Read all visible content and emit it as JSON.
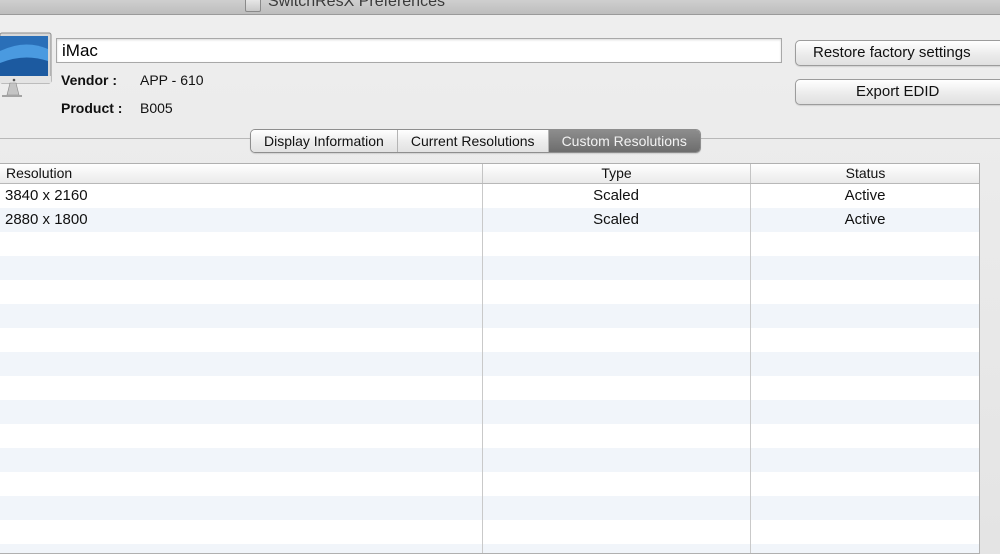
{
  "window": {
    "title": "SwitchResX Preferences"
  },
  "display": {
    "name": "iMac",
    "vendor_label": "Vendor :",
    "vendor_value": "APP - 610",
    "product_label": "Product :",
    "product_value": "B005"
  },
  "buttons": {
    "restore": "Restore factory settings",
    "export": "Export EDID"
  },
  "tabs": [
    {
      "label": "Display Information",
      "selected": false
    },
    {
      "label": "Current Resolutions",
      "selected": false
    },
    {
      "label": "Custom Resolutions",
      "selected": true
    }
  ],
  "table": {
    "columns": [
      "Resolution",
      "Type",
      "Status"
    ],
    "rows": [
      {
        "resolution": "3840 x 2160",
        "type": "Scaled",
        "status": "Active"
      },
      {
        "resolution": "2880 x 1800",
        "type": "Scaled",
        "status": "Active"
      }
    ]
  },
  "icons": {
    "display": "imac-icon",
    "app": "switchresx-app-icon"
  },
  "colors": {
    "selected_tab": "#7a7a7a",
    "alt_row": "#f1f5fa"
  }
}
